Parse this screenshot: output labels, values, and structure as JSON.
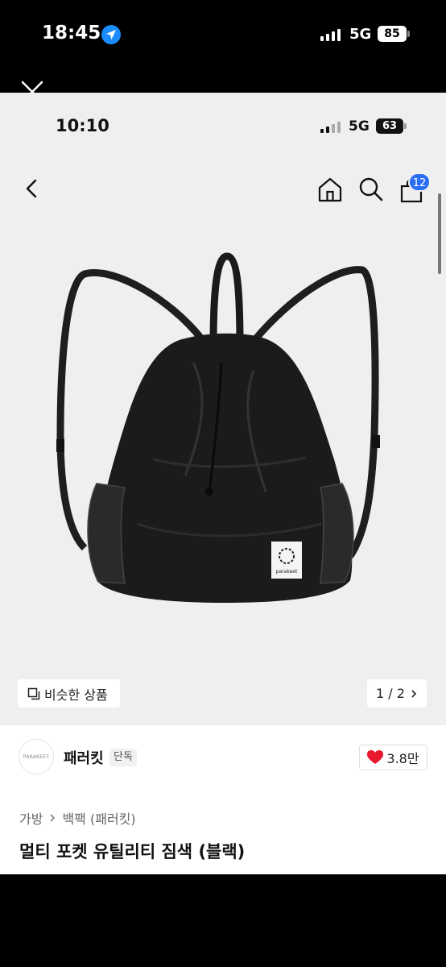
{
  "outer_status": {
    "time": "18:45",
    "network": "5G",
    "battery": "85"
  },
  "inner_status": {
    "time": "10:10",
    "network": "5G",
    "battery": "63"
  },
  "header": {
    "cart_count": "12"
  },
  "product_image": {
    "brand_label": "parakeet",
    "page": "1 / 2"
  },
  "similar_button": {
    "label": "비슷한 상품"
  },
  "brand": {
    "logo_text": "PARAKEET",
    "name": "패러킷",
    "tag": "단독",
    "likes": "3.8만"
  },
  "breadcrumb": {
    "level1": "가방",
    "level2": "백팩 (패러킷)"
  },
  "product": {
    "title": "멀티 포켓 유틸리티 짐색 (블랙)"
  },
  "colors": {
    "accent_blue": "#2b6ef5",
    "heart_red": "#e8192c",
    "location_blue": "#1a8cff"
  }
}
